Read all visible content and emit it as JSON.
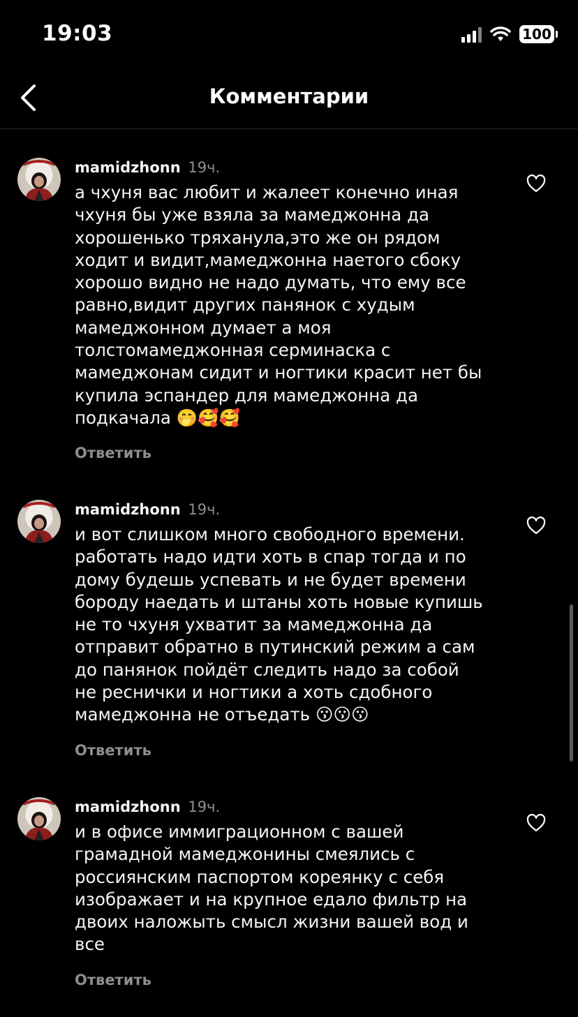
{
  "status_bar": {
    "time": "19:03",
    "battery": "100"
  },
  "nav": {
    "title": "Комментарии"
  },
  "comments": [
    {
      "username": "mamidzhonn",
      "time": "19ч.",
      "text": "а чхуня вас любит и жалеет конечно иная\nчхуня бы уже взяла за мамеджонна да\nхорошенько тряханула,это же он рядом\nходит и видит,мамеджонна наетого сбоку\nхорошо видно не надо думать, что ему все\nравно,видит других панянок с худым\nмамеджонном думает а моя\nтолстомамеджонная серминаска с\nмамеджонам сидит и ногтики красит нет бы\nкупила эспандер для мамеджонна да\nподкачала 🤭🥰🥰",
      "reply": "Ответить"
    },
    {
      "username": "mamidzhonn",
      "time": "19ч.",
      "text": "и вот слишком много свободного времени.\nработать надо идти хоть в спар тогда и по\nдому будешь успевать и не будет времени\nбороду наедать и штаны хоть новые купишь\nне то чхуня ухватит за мамеджонна да\nотправит обратно в путинский режим а сам\nдо панянок пойдёт следить надо за собой\nне реснички и ногтики а хоть сдобного\nмамеджонна не отъедать 😗😗😗",
      "reply": "Ответить"
    },
    {
      "username": "mamidzhonn",
      "time": "19ч.",
      "text": "и в офисе иммиграционном с вашей\nграмадной мамеджонины смеялись с\nроссиянским паспортом кореянку с себя\nизображает и на крупное едало фильтр на\nдвоих наложыть смысл жизни вашей вод и\nвсе",
      "reply": "Ответить"
    }
  ]
}
